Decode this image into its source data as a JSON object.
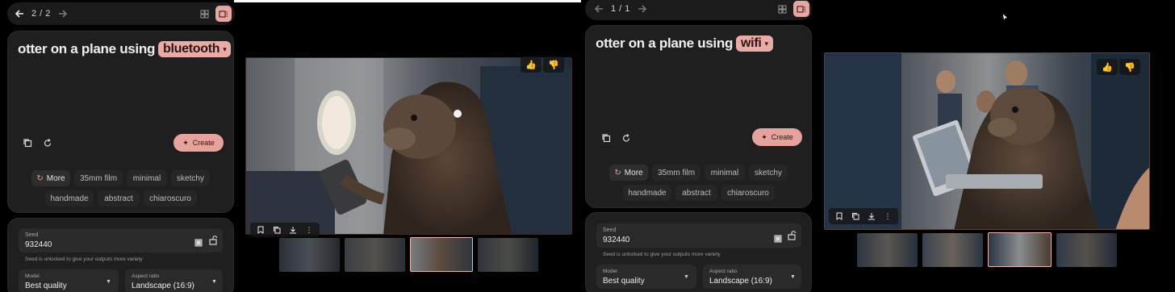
{
  "left": {
    "pager": "2 / 2",
    "prompt_text": "otter on a plane using",
    "keyword": "bluetooth",
    "create_label": "Create",
    "more_label": "More",
    "styles": [
      "35mm film",
      "minimal",
      "sketchy",
      "handmade",
      "abstract",
      "chiaroscuro"
    ],
    "seed_label": "Seed",
    "seed_value": "932440",
    "seed_note": "Seed is unlocked to give your outputs more variety",
    "model_label": "Model",
    "model_value": "Best quality",
    "aspect_label": "Aspect ratio",
    "aspect_value": "Landscape (16:9)"
  },
  "right": {
    "pager": "1 / 1",
    "prompt_text": "otter on a plane using",
    "keyword": "wifi",
    "create_label": "Create",
    "more_label": "More",
    "styles": [
      "35mm film",
      "minimal",
      "sketchy",
      "handmade",
      "abstract",
      "chiaroscuro"
    ],
    "seed_label": "Seed",
    "seed_value": "932440",
    "seed_note": "Seed is unlocked to give your outputs more variety",
    "model_label": "Model",
    "model_value": "Best quality",
    "aspect_label": "Aspect ratio",
    "aspect_value": "Landscape (16:9)"
  },
  "colors": {
    "accent": "#e6a39c",
    "panel": "#1f1f20",
    "background": "#000000"
  },
  "icons": [
    "arrow-left-icon",
    "arrow-right-icon",
    "grid-view-icon",
    "single-view-icon",
    "copy-icon",
    "reset-icon",
    "sparkle-icon",
    "refresh-icon",
    "thumbs-up-icon",
    "thumbs-down-icon",
    "bookmark-icon",
    "download-icon",
    "more-vert-icon",
    "lock-open-icon",
    "dice-icon",
    "cursor-icon"
  ]
}
